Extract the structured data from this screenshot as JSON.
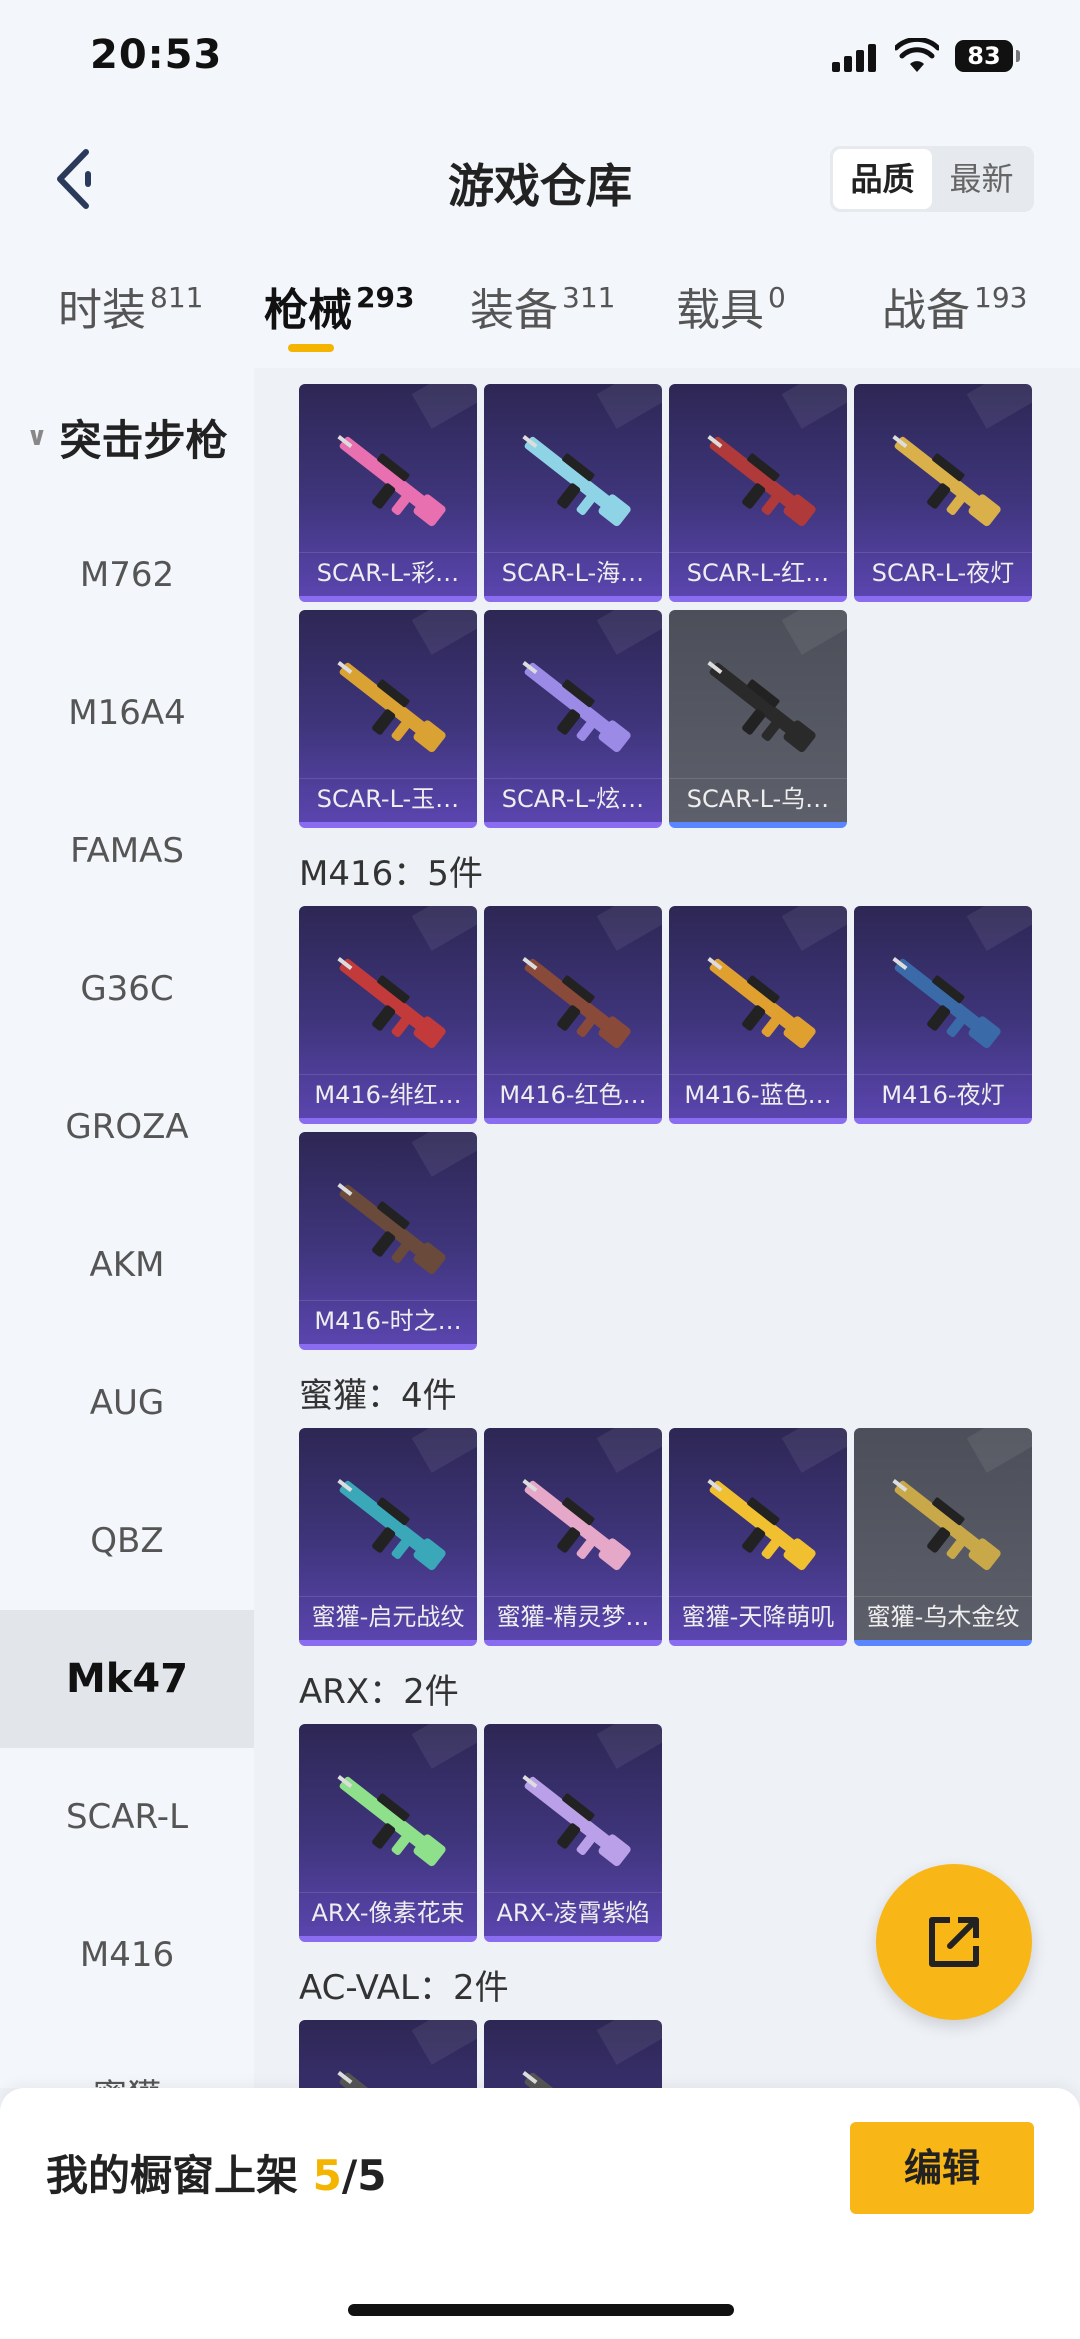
{
  "status": {
    "time": "20:53",
    "battery": "83"
  },
  "header": {
    "title": "游戏仓库",
    "sort_quality": "品质",
    "sort_newest": "最新"
  },
  "tabs": [
    {
      "label": "时装",
      "count": "811"
    },
    {
      "label": "枪械",
      "count": "293"
    },
    {
      "label": "装备",
      "count": "311"
    },
    {
      "label": "载具",
      "count": "0"
    },
    {
      "label": "战备",
      "count": "193"
    }
  ],
  "sidebar": {
    "category": "突击步枪",
    "items": [
      "M762",
      "M16A4",
      "FAMAS",
      "G36C",
      "GROZA",
      "AKM",
      "AUG",
      "QBZ",
      "Mk47",
      "SCAR-L",
      "M416",
      "蜜獾"
    ],
    "selected": "Mk47"
  },
  "sections": [
    {
      "title": "",
      "items": [
        {
          "name": "SCAR-L-彩…",
          "color": "#e86fb0"
        },
        {
          "name": "SCAR-L-海…",
          "color": "#8fd4e6"
        },
        {
          "name": "SCAR-L-红…",
          "color": "#b03a3a"
        },
        {
          "name": "SCAR-L-夜灯",
          "color": "#d9b04a"
        },
        {
          "name": "SCAR-L-玉…",
          "color": "#d9a233"
        },
        {
          "name": "SCAR-L-炫…",
          "color": "#9b8ae6"
        },
        {
          "name": "SCAR-L-乌…",
          "color": "#2a2a2a",
          "grey": true
        }
      ]
    },
    {
      "title": "M416：5件",
      "items": [
        {
          "name": "M416-绯红…",
          "color": "#c23a3a"
        },
        {
          "name": "M416-红色…",
          "color": "#8a4a3a"
        },
        {
          "name": "M416-蓝色…",
          "color": "#e0a030"
        },
        {
          "name": "M416-夜灯",
          "color": "#3a6aa8"
        },
        {
          "name": "M416-时之…",
          "color": "#6a4a3a"
        }
      ]
    },
    {
      "title": "蜜獾：4件",
      "items": [
        {
          "name": "蜜獾-启元战纹",
          "color": "#3aa8b8"
        },
        {
          "name": "蜜獾-精灵梦…",
          "color": "#e6a8c8"
        },
        {
          "name": "蜜獾-天降萌叽",
          "color": "#f0c030"
        },
        {
          "name": "蜜獾-乌木金纹",
          "color": "#c9a84a",
          "grey": true
        }
      ]
    },
    {
      "title": "ARX：2件",
      "items": [
        {
          "name": "ARX-像素花束",
          "color": "#8ee08a"
        },
        {
          "name": "ARX-凌霄紫焰",
          "color": "#b9a0e8"
        }
      ]
    },
    {
      "title": "AC-VAL：2件",
      "items": [
        {
          "name": "",
          "color": "#555555"
        },
        {
          "name": "",
          "color": "#555555"
        }
      ]
    }
  ],
  "bottom": {
    "label": "我的橱窗上架",
    "current": "5",
    "total": "/5",
    "edit": "编辑"
  },
  "icons": {
    "back": "chevron-left-icon",
    "fab": "share-external-icon"
  }
}
